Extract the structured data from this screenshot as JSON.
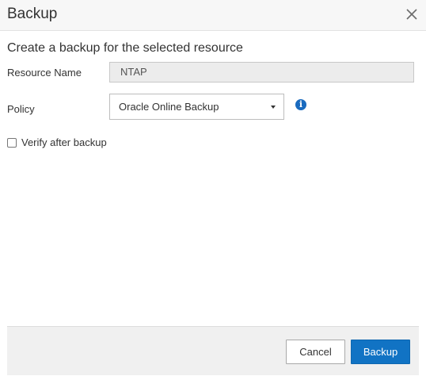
{
  "dialog": {
    "title": "Backup",
    "subtitle": "Create a backup for the selected resource",
    "close_icon": "close-icon"
  },
  "form": {
    "resource_name_label": "Resource Name",
    "resource_name_value": "NTAP",
    "policy_label": "Policy",
    "policy_selected": "Oracle Online Backup",
    "policy_info_icon": "info-icon",
    "verify_label": "Verify after backup",
    "verify_checked": false
  },
  "footer": {
    "cancel_label": "Cancel",
    "backup_label": "Backup"
  },
  "colors": {
    "primary": "#1173c4",
    "info": "#1a6bbf"
  }
}
